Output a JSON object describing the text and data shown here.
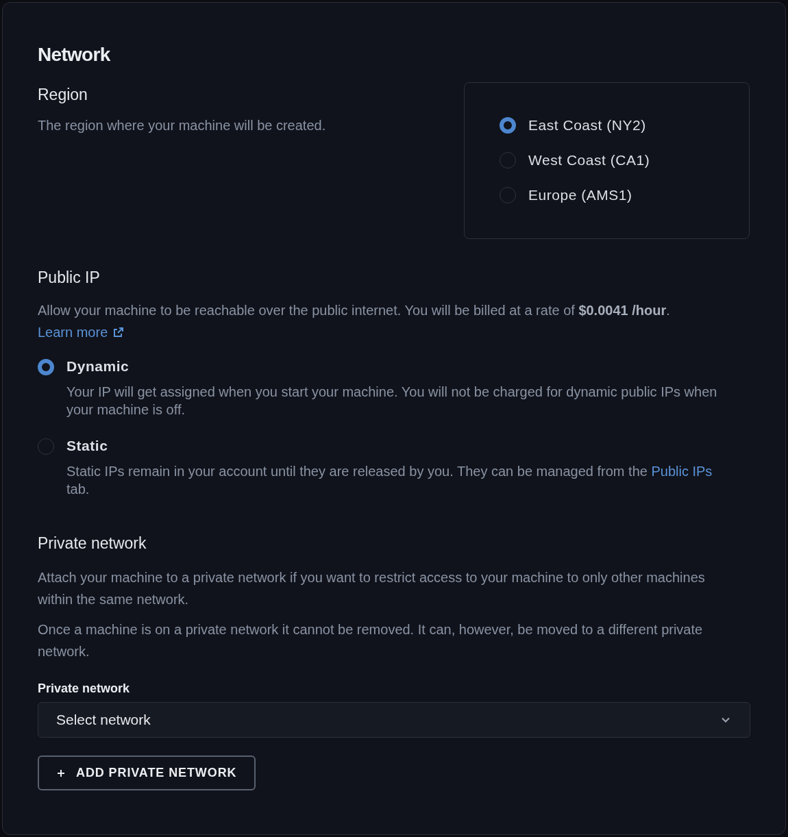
{
  "title": "Network",
  "region": {
    "heading": "Region",
    "description": "The region where your machine will be created.",
    "options": [
      {
        "label": "East Coast (NY2)",
        "selected": true
      },
      {
        "label": "West Coast (CA1)",
        "selected": false
      },
      {
        "label": "Europe (AMS1)",
        "selected": false
      }
    ]
  },
  "public_ip": {
    "heading": "Public IP",
    "description": "Allow your machine to be reachable over the public internet. You will be billed at a rate of **$0.0041 /hour**.",
    "link": "Learn more",
    "options": [
      {
        "label": "Dynamic",
        "selected": true,
        "description": "Your IP will get assigned when you start your machine. You will not be charged for dynamic public IPs when your machine is off."
      },
      {
        "label": "Static",
        "selected": false,
        "description": "Static IPs remain in your account until they are released by you. They can be managed from the",
        "link": "Public IPs",
        "description_end": "tab."
      }
    ]
  },
  "private_network": {
    "heading": "Private network",
    "paragraphs": [
      "Attach your machine to a private network if you want to restrict access to your machine to only other machines within the same network.",
      "Once a machine is on a private network it cannot be removed. It can, however, be moved to a different private network."
    ],
    "field_label": "Private network",
    "select": {
      "placeholder": "Select network"
    },
    "button": "ADD PRIVATE NETWORK"
  }
}
